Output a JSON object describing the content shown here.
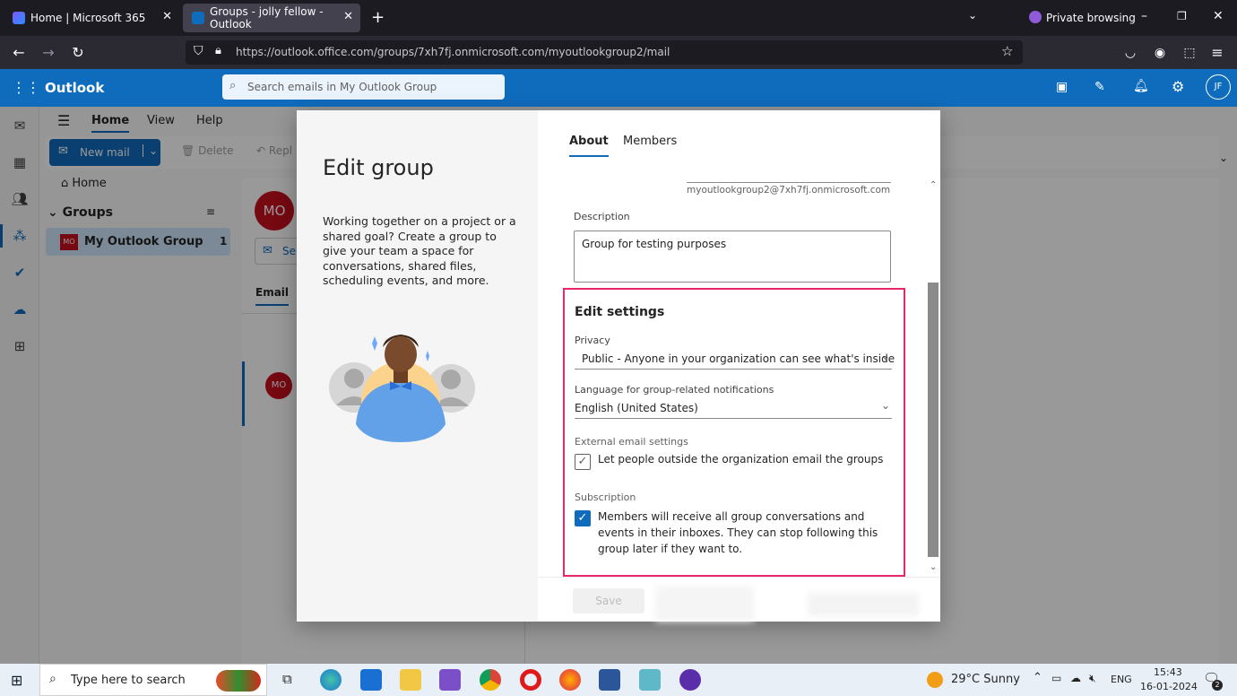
{
  "browser": {
    "tabs": [
      {
        "title": "Home | Microsoft 365"
      },
      {
        "title": "Groups - jolly fellow - Outlook"
      }
    ],
    "private_label": "Private browsing",
    "url": "https://outlook.office.com/groups/7xh7fj.onmicrosoft.com/myoutlookgroup2/mail"
  },
  "outlook": {
    "app_name": "Outlook",
    "search_placeholder": "Search emails in My Outlook Group",
    "avatar": "JF",
    "ribbon_tabs": [
      "Home",
      "View",
      "Help"
    ],
    "new_mail": "New mail",
    "delete": "Delete",
    "reply": "Repl",
    "nav": {
      "home": "Home",
      "groups": "Groups",
      "group_name": "My Outlook Group",
      "group_badge": "MO",
      "group_count": "1"
    },
    "header_badge": "MO",
    "send_partial": "Se",
    "email_tab": "Email",
    "msg_badge": "MO"
  },
  "dialog": {
    "title": "Edit group",
    "intro": "Working together on a project or a shared goal? Create a group to give your team a space for conversations, shared files, scheduling events, and more.",
    "tabs": [
      "About",
      "Members"
    ],
    "email_address": "myoutlookgroup2@7xh7fj.onmicrosoft.com",
    "description_label": "Description",
    "description_value": "Group for testing purposes",
    "settings_title": "Edit settings",
    "privacy_label": "Privacy",
    "privacy_value": "Public - Anyone in your organization can see what's inside",
    "language_label": "Language for group-related notifications",
    "language_value": "English (United States)",
    "external_label": "External email settings",
    "external_option": "Let people outside the organization email the groups",
    "external_checked": false,
    "subscription_label": "Subscription",
    "subscription_option": "Members will receive all group conversations and events in their inboxes. They can stop following this group later if they want to.",
    "subscription_checked": true,
    "save": "Save"
  },
  "taskbar": {
    "search_placeholder": "Type here to search",
    "weather": "29°C  Sunny",
    "lang": "ENG",
    "time": "15:43",
    "date": "16-01-2024",
    "notif_count": "2"
  },
  "colors": {
    "accent": "#0f6cbd",
    "highlight": "#e6276b",
    "avatar_red": "#c50f1f"
  }
}
